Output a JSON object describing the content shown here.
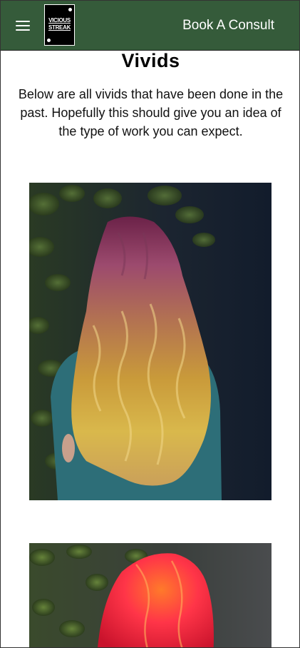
{
  "header": {
    "menu_icon": "hamburger-menu-icon",
    "logo_text_line1": "VICIOUS",
    "logo_text_line2": "STREAK",
    "cta_label": "Book A Consult",
    "background_color": "#355b3a"
  },
  "main": {
    "title": "Vivids",
    "intro": "Below are all vivids that have been done in the past. Hopefully this should give you an idea of the type of work you can expect."
  },
  "gallery": {
    "items": [
      {
        "description": "long wavy hair, purple roots fading to gold ends"
      },
      {
        "description": "bright red and orange hair"
      }
    ]
  }
}
